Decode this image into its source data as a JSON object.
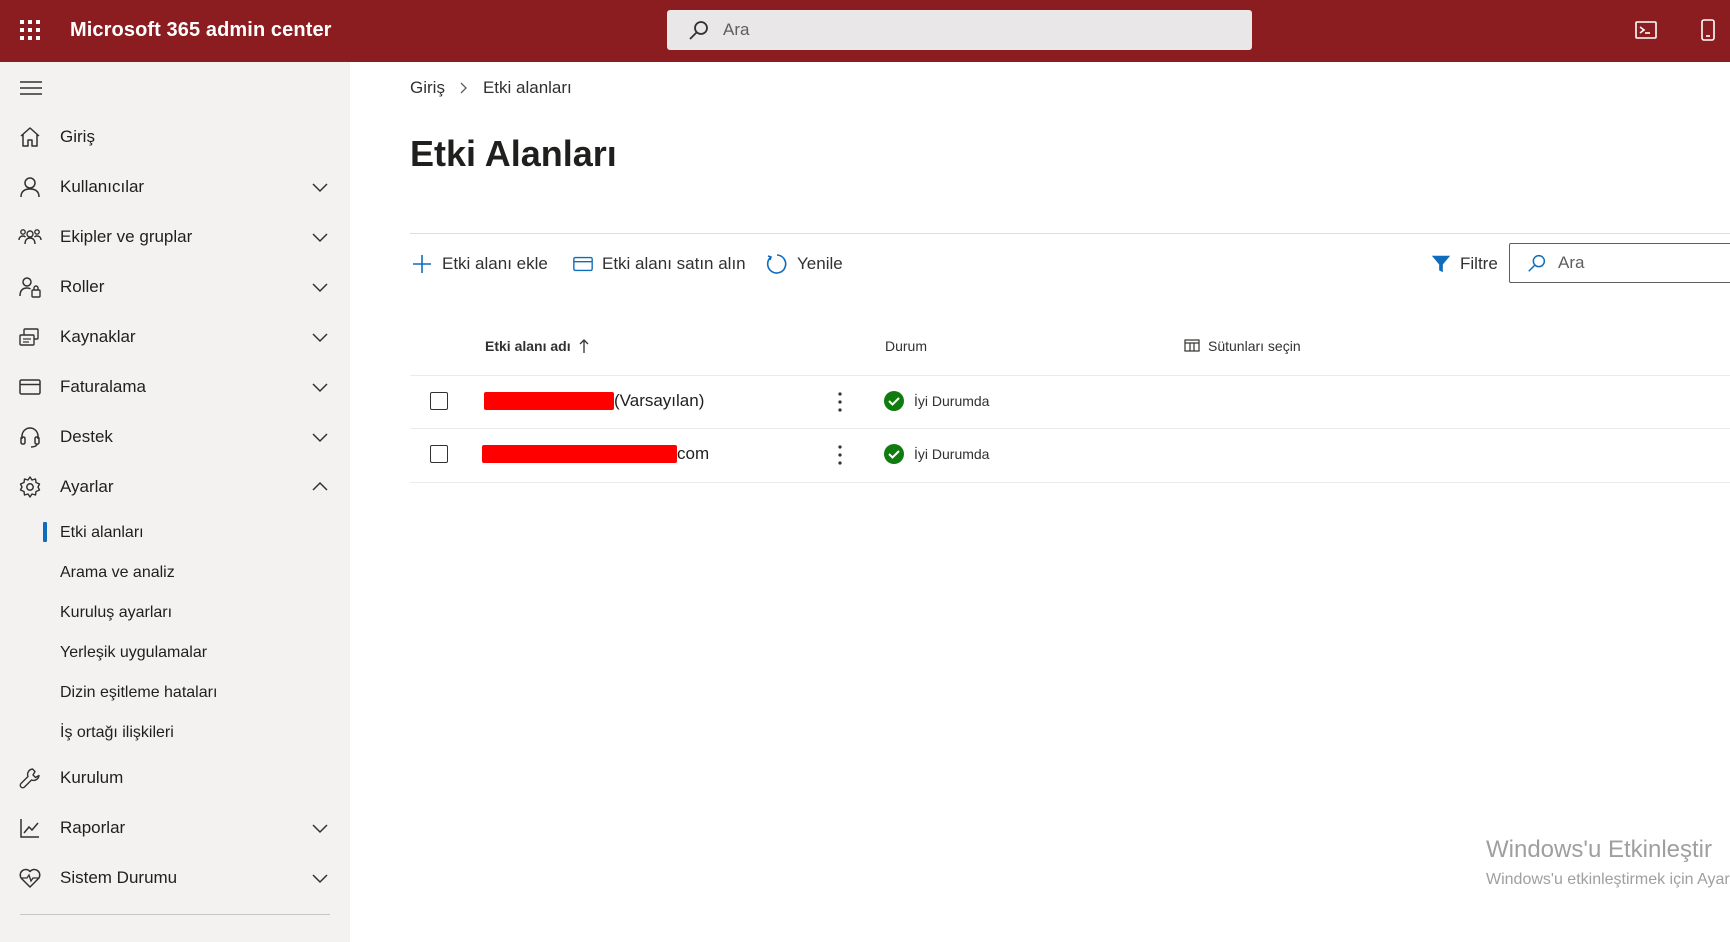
{
  "header": {
    "app_title": "Microsoft 365 admin center",
    "search_placeholder": "Ara",
    "bg_color": "#8b1c20"
  },
  "sidebar": {
    "items": [
      {
        "label": "Giriş",
        "icon": "home-icon",
        "expandable": false
      },
      {
        "label": "Kullanıcılar",
        "icon": "user-icon",
        "expandable": true
      },
      {
        "label": "Ekipler ve gruplar",
        "icon": "teams-icon",
        "expandable": true
      },
      {
        "label": "Roller",
        "icon": "roles-icon",
        "expandable": true
      },
      {
        "label": "Kaynaklar",
        "icon": "resources-icon",
        "expandable": true
      },
      {
        "label": "Faturalama",
        "icon": "billing-icon",
        "expandable": true
      },
      {
        "label": "Destek",
        "icon": "headset-icon",
        "expandable": true
      },
      {
        "label": "Ayarlar",
        "icon": "gear-icon",
        "expandable": true,
        "expanded": true
      }
    ],
    "settings_sub": [
      {
        "label": "Etki alanları",
        "active": true
      },
      {
        "label": "Arama ve analiz"
      },
      {
        "label": "Kuruluş ayarları"
      },
      {
        "label": "Yerleşik uygulamalar"
      },
      {
        "label": "Dizin eşitleme hataları"
      },
      {
        "label": "İş ortağı ilişkileri"
      }
    ],
    "bottom_items": [
      {
        "label": "Kurulum",
        "icon": "wrench-icon",
        "expandable": false
      },
      {
        "label": "Raporlar",
        "icon": "chart-icon",
        "expandable": true
      },
      {
        "label": "Sistem Durumu",
        "icon": "heart-icon",
        "expandable": true
      }
    ]
  },
  "breadcrumb": {
    "home": "Giriş",
    "current": "Etki alanları"
  },
  "page": {
    "title": "Etki Alanları"
  },
  "commands": {
    "add": "Etki alanı ekle",
    "buy": "Etki alanı satın alın",
    "refresh": "Yenile",
    "filter": "Filtre",
    "search_placeholder": "Ara"
  },
  "table": {
    "columns": {
      "name": "Etki alanı adı",
      "status": "Durum",
      "choose_columns": "Sütunları seçin"
    },
    "rows": [
      {
        "name_suffix": "(Varsayılan)",
        "status": "İyi Durumda"
      },
      {
        "name_suffix": "com",
        "status": "İyi Durumda"
      }
    ]
  },
  "watermark": {
    "title": "Windows'u Etkinleştir",
    "subtitle": "Windows'u etkinleştirmek için Ayarlar'a gidin."
  }
}
